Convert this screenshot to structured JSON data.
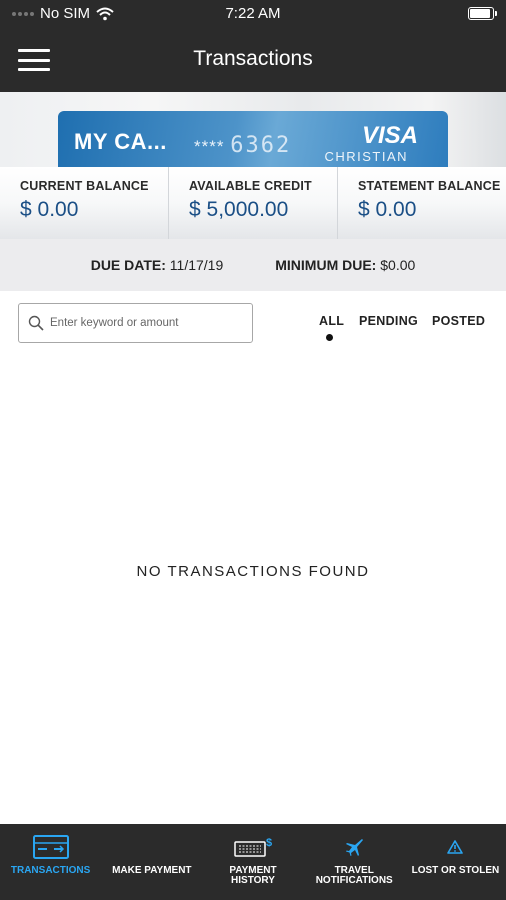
{
  "status": {
    "carrier": "No SIM",
    "time": "7:22 AM"
  },
  "header": {
    "title": "Transactions"
  },
  "card": {
    "name": "MY CA...",
    "number_mask": "****",
    "last4": "6362",
    "brand": "VISA",
    "issuer": "CHRISTIAN"
  },
  "balances": [
    {
      "label": "CURRENT BALANCE",
      "value": "$ 0.00"
    },
    {
      "label": "AVAILABLE CREDIT",
      "value": "$ 5,000.00"
    },
    {
      "label": "STATEMENT BALANCE",
      "value": "$ 0.00"
    }
  ],
  "due": {
    "due_label": "DUE DATE:",
    "due_value": "11/17/19",
    "min_label": "MINIMUM DUE:",
    "min_value": "$0.00"
  },
  "search": {
    "placeholder": "Enter keyword or amount"
  },
  "filters": {
    "all": "ALL",
    "pending": "PENDING",
    "posted": "POSTED",
    "selected": "ALL"
  },
  "empty_message": "NO TRANSACTIONS FOUND",
  "tabs": [
    {
      "label": "TRANSACTIONS",
      "icon": "card-icon",
      "active": true
    },
    {
      "label": "MAKE PAYMENT",
      "icon": "",
      "active": false
    },
    {
      "label": "PAYMENT HISTORY",
      "icon": "payment-history-icon",
      "active": false
    },
    {
      "label": "TRAVEL NOTIFICATIONS",
      "icon": "airplane-icon",
      "active": false
    },
    {
      "label": "LOST OR STOLEN",
      "icon": "warning-icon",
      "active": false
    }
  ],
  "colors": {
    "bar": "#2b2b2b",
    "accent": "#2aa6f2",
    "balance_value": "#1b4f86",
    "card_blue": "#1f6fb0"
  }
}
